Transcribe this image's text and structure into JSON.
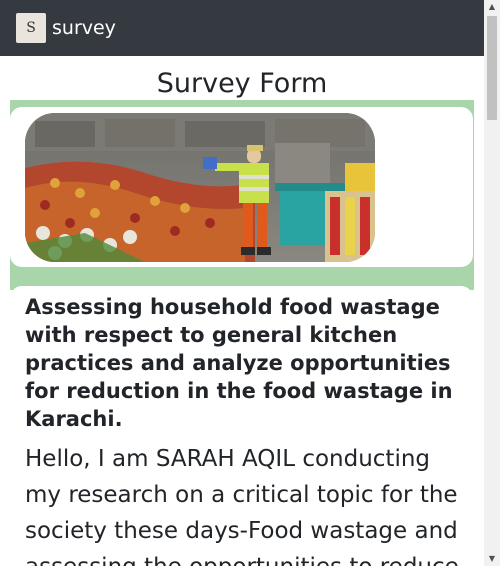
{
  "navbar": {
    "logo_letter": "S",
    "brand": "survey"
  },
  "main": {
    "title": "Survey Form",
    "image": {
      "icon": "food-waste-photo"
    },
    "card": {
      "heading": "Assessing household food wastage with respect to general kitchen practices and analyze opportunities for reduction in the food wastage in Karachi.",
      "body": "Hello, I am SARAH AQIL conducting my research on a critical topic for the society these days-Food wastage and assessing the opportunities to reduce"
    }
  },
  "colors": {
    "navbar": "#343a40",
    "green_band": "#a8d5aa"
  },
  "scrollbar": {
    "up_icon": "triangle-up-icon",
    "down_icon": "triangle-down-icon"
  }
}
